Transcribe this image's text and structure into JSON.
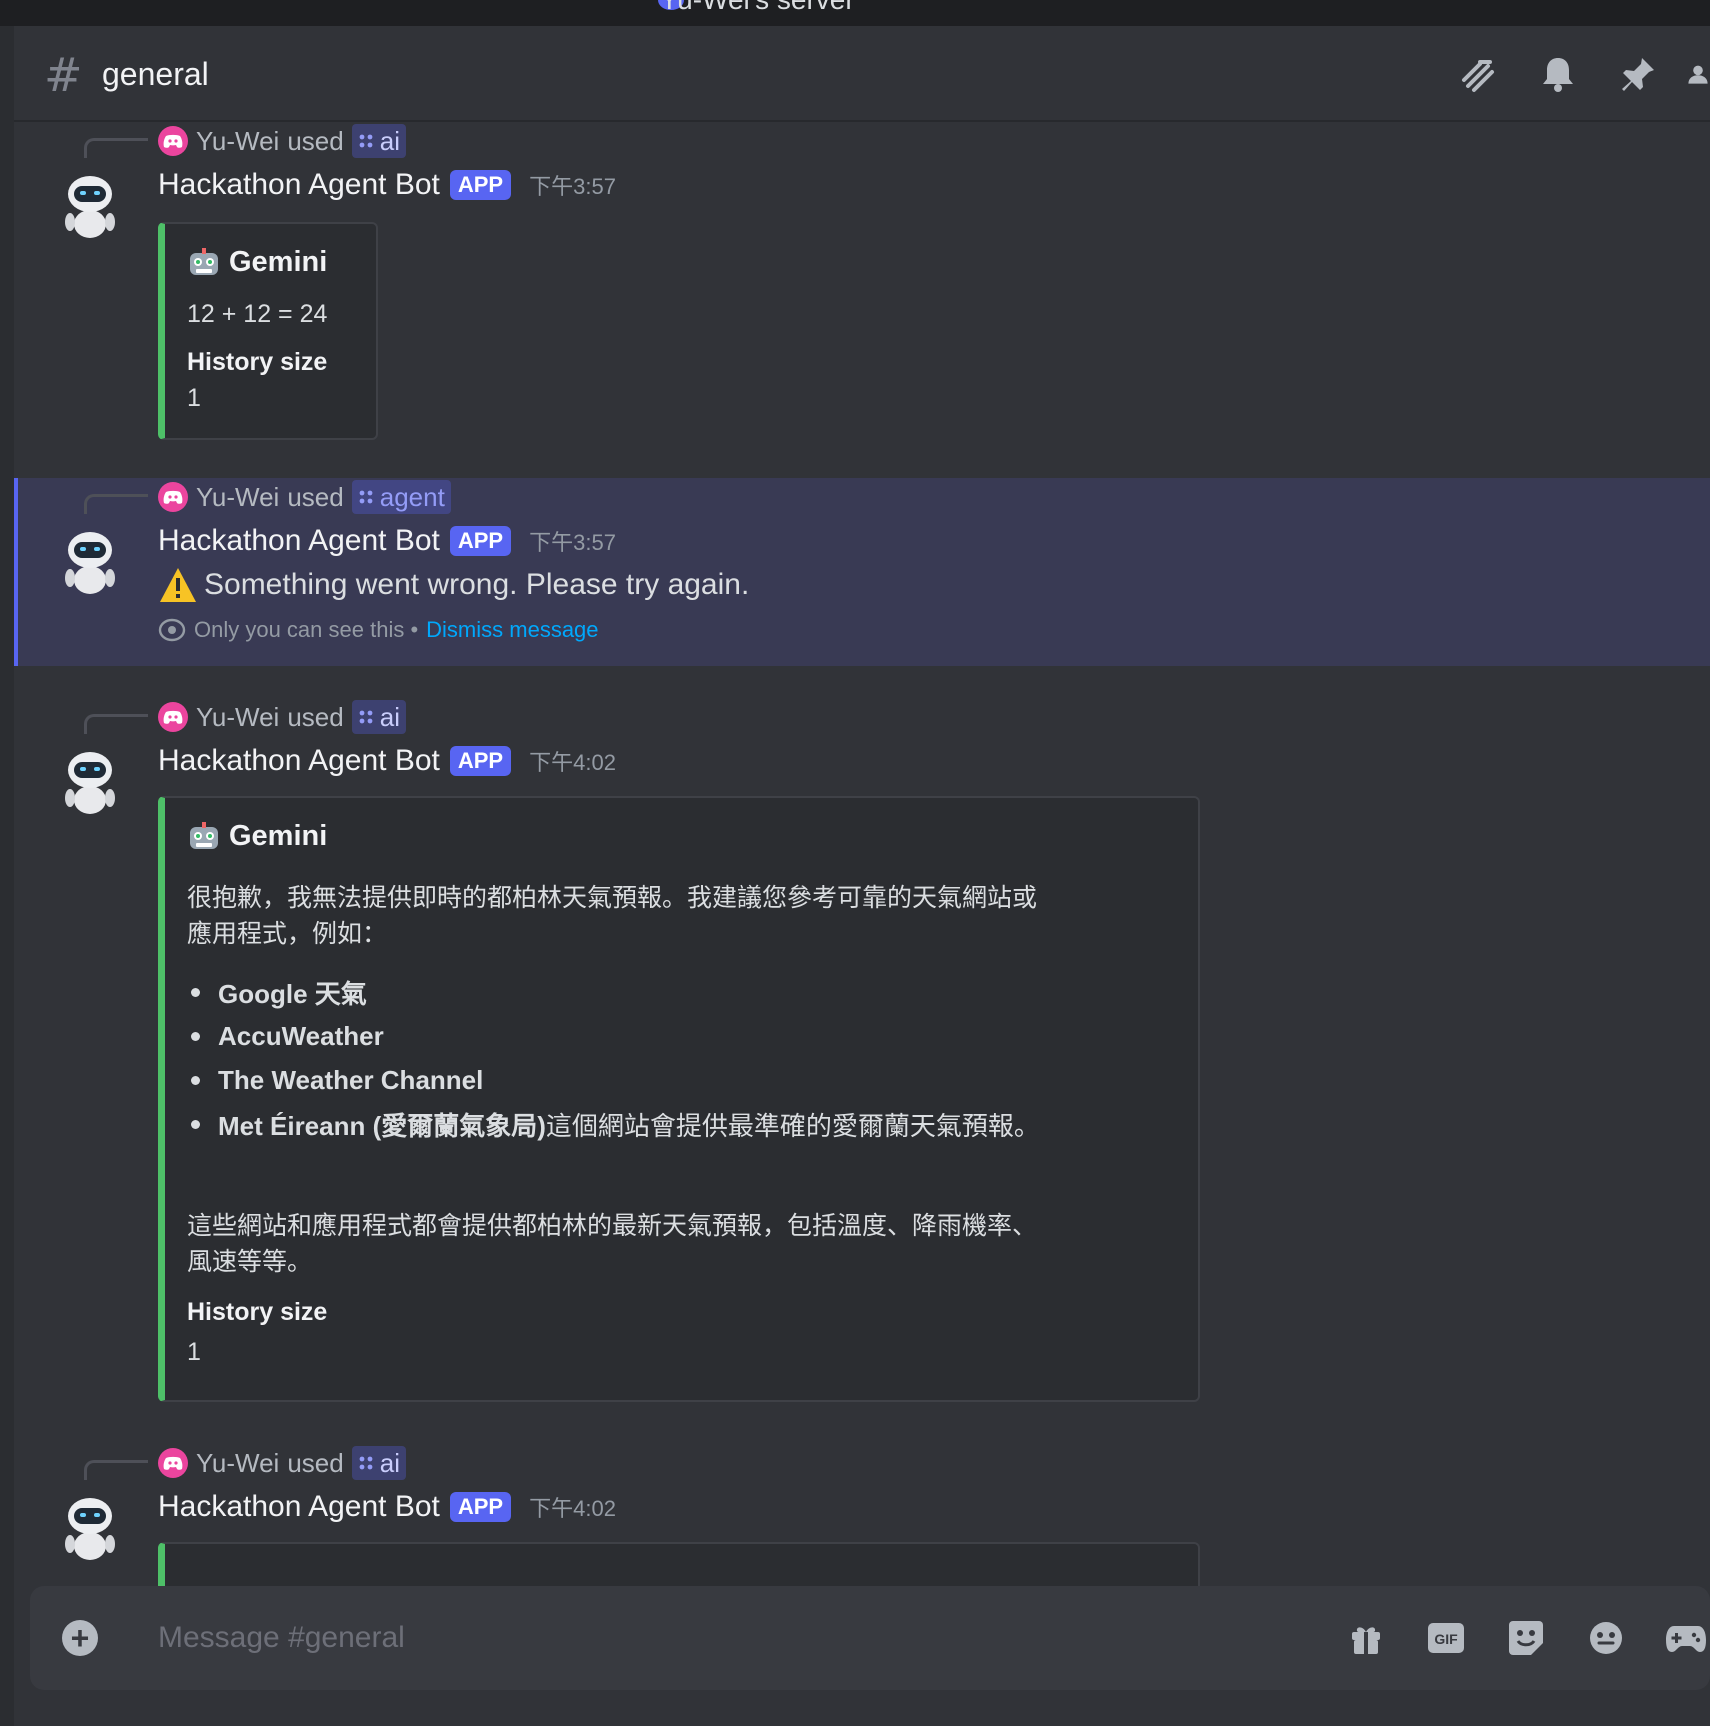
{
  "server": {
    "name": "Yu-Wei's server"
  },
  "channel": {
    "name": "general"
  },
  "header": {
    "icons": [
      "threads-icon",
      "bell-icon",
      "pin-icon",
      "members-icon"
    ]
  },
  "messages": [
    {
      "reply_user": "Yu-Wei",
      "used_text": "used",
      "command": "ai",
      "bot_name": "Hackathon Agent Bot",
      "badge": "APP",
      "time": "下午3:57",
      "embed": {
        "title": "Gemini",
        "description": "12 + 12 = 24",
        "field_name": "History size",
        "field_value": "1"
      }
    },
    {
      "reply_user": "Yu-Wei",
      "used_text": "used",
      "command": "agent",
      "bot_name": "Hackathon Agent Bot",
      "badge": "APP",
      "time": "下午3:57",
      "error_text": "Something went wrong. Please try again.",
      "ephemeral_text": "Only you can see this •",
      "dismiss_text": "Dismiss message"
    },
    {
      "reply_user": "Yu-Wei",
      "used_text": "used",
      "command": "ai",
      "bot_name": "Hackathon Agent Bot",
      "badge": "APP",
      "time": "下午4:02",
      "embed": {
        "title": "Gemini",
        "line1": "很抱歉，我無法提供即時的都柏林天氣預報。我建議您參考可靠的天氣網站或",
        "line2": "應用程式，例如：",
        "bullets": [
          {
            "bold": "Google 天氣",
            "rest": ""
          },
          {
            "bold": "AccuWeather",
            "rest": ""
          },
          {
            "bold": "The Weather Channel",
            "rest": ""
          },
          {
            "bold": "Met Éireann (愛爾蘭氣象局)",
            "rest": " 這個網站會提供最準確的愛爾蘭天氣預報。"
          }
        ],
        "line3": "這些網站和應用程式都會提供都柏林的最新天氣預報，包括溫度、降雨機率、",
        "line4": "風速等等。",
        "field_name": "History size",
        "field_value": "1"
      }
    },
    {
      "reply_user": "Yu-Wei",
      "used_text": "used",
      "command": "ai",
      "bot_name": "Hackathon Agent Bot",
      "badge": "APP",
      "time": "下午4:02"
    }
  ],
  "composer": {
    "placeholder": "Message #general",
    "gif_label": "GIF"
  }
}
